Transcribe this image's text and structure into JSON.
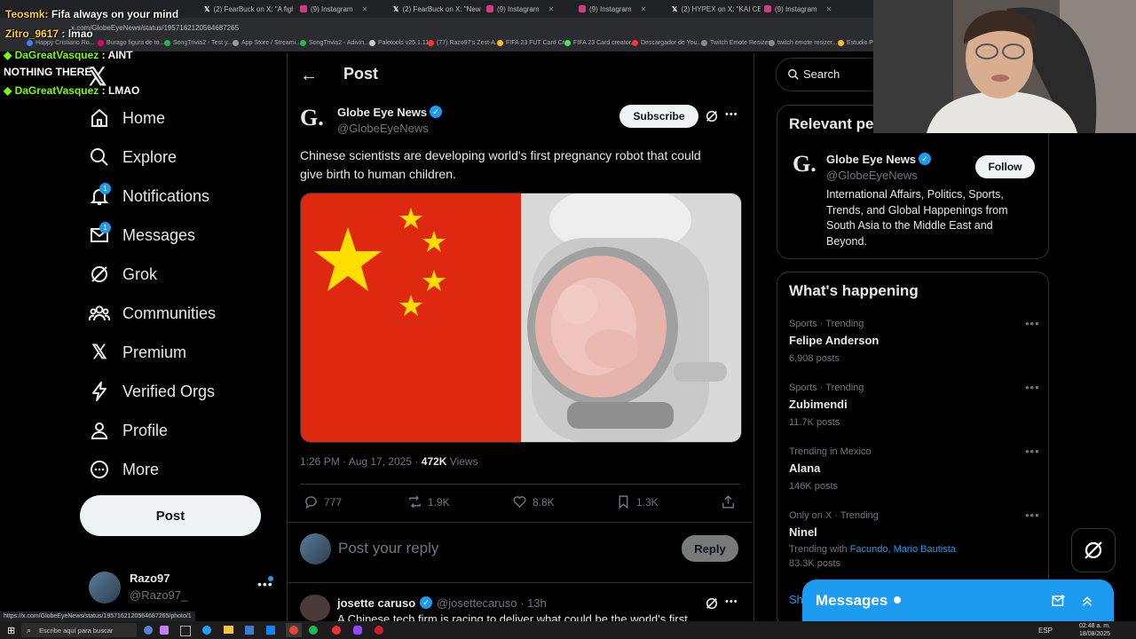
{
  "browser": {
    "tabs": [
      {
        "title": "(2) FearBuck on X: \"A figh",
        "icon": "x"
      },
      {
        "title": "(9) Instagram",
        "icon": "ig"
      },
      {
        "title": "(2) FearBuck on X: \"New p",
        "icon": "x"
      },
      {
        "title": "(9) Instagram",
        "icon": "ig"
      },
      {
        "title": "(9) Instagram",
        "icon": "ig"
      },
      {
        "title": "(2) HYPEX on X: \"KAI CEN",
        "icon": "x"
      },
      {
        "title": "(9) Instagram",
        "icon": "ig"
      }
    ],
    "url": "x.com/GlobeEyeNews/status/1957162120564687265",
    "bookmarks": [
      "Happy Cristiano Ro...",
      "Burago figura de to...",
      "SongTrivia2 - Test y...",
      "App Store / Streami...",
      "SongTrivia2 - Adivin...",
      "Paletools v25.1.11",
      "(77) Razo97's Zest-A...",
      "FIFA 23 FUT Card Cr...",
      "FIFA 23 Card creator...",
      "Descargador de You...",
      "Twitch Emote Resizer",
      "twitch emote resizer...",
      "Estudio Privado"
    ]
  },
  "chat": [
    {
      "user": "Teosmk",
      "msg": "Fifa always on your mind",
      "color": "yellow"
    },
    {
      "user": "Zitro_9617",
      "msg": "lmao",
      "color": "yellow"
    },
    {
      "user": "DaGreatVasquez",
      "msg": "AINT NOTHING THERE",
      "color": "green"
    },
    {
      "user": "DaGreatVasquez",
      "msg": "LMAO",
      "color": "green"
    }
  ],
  "sidebar": {
    "items": [
      {
        "label": "Home",
        "icon": "home-icon"
      },
      {
        "label": "Explore",
        "icon": "search-icon"
      },
      {
        "label": "Notifications",
        "icon": "bell-icon",
        "badge": "1"
      },
      {
        "label": "Messages",
        "icon": "mail-icon",
        "badge": "1"
      },
      {
        "label": "Grok",
        "icon": "grok-icon"
      },
      {
        "label": "Communities",
        "icon": "people-icon"
      },
      {
        "label": "Premium",
        "icon": "x-logo-icon"
      },
      {
        "label": "Verified Orgs",
        "icon": "bolt-icon"
      },
      {
        "label": "Profile",
        "icon": "person-icon"
      },
      {
        "label": "More",
        "icon": "more-circle-icon"
      }
    ],
    "post_label": "Post",
    "account": {
      "name": "Razo97",
      "handle": "@Razo97_"
    }
  },
  "post": {
    "header": "Post",
    "author": {
      "name": "Globe Eye News",
      "handle": "@GlobeEyeNews",
      "avatar_letter": "G."
    },
    "subscribe_label": "Subscribe",
    "text": "Chinese scientists are developing world's first pregnancy robot that could give birth to human children.",
    "time": "1:26 PM · Aug 17, 2025 ·",
    "views_count": "472K",
    "views_label": "Views",
    "stats": {
      "replies": "777",
      "reposts": "1.9K",
      "likes": "8.8K",
      "bookmarks": "1.3K"
    },
    "reply_placeholder": "Post your reply",
    "reply_button": "Reply"
  },
  "reply": {
    "name": "josette caruso",
    "handle": "@josettecaruso · 13h",
    "text": "A Chinese tech firm is racing to deliver what could be the world's first"
  },
  "right": {
    "search_placeholder": "Search",
    "relevant_title": "Relevant people",
    "relevant": {
      "name": "Globe Eye News",
      "handle": "@GlobeEyeNews",
      "bio": "International Affairs, Politics, Sports, Trends, and Global Happenings from South Asia to the Middle East and Beyond.",
      "follow_label": "Follow"
    },
    "happening_title": "What's happening",
    "trends": [
      {
        "meta": "Sports · Trending",
        "name": "Felipe Anderson",
        "count": "6,908 posts"
      },
      {
        "meta": "Sports · Trending",
        "name": "Zubimendi",
        "count": "11.7K posts"
      },
      {
        "meta": "Trending in Mexico",
        "name": "Alana",
        "count": "146K posts"
      },
      {
        "meta": "Only on X · Trending",
        "name": "Ninel",
        "with_label": "Trending with",
        "with": "Facundo, Mario Bautista",
        "count": "83.3K posts"
      }
    ],
    "show_more": "Show more",
    "messages_label": "Messages"
  },
  "status_url": "https://x.com/GlobeEyeNews/status/1957162120564687265/photo/1",
  "taskbar": {
    "search_placeholder": "Escribe aquí para buscar",
    "lang": "ESP",
    "time": "02:48 a. m.",
    "date": "18/08/2025"
  },
  "colors": {
    "accent": "#1d9bf0",
    "background": "#000000",
    "flag_red": "#de2910",
    "flag_yellow": "#ffde00"
  }
}
